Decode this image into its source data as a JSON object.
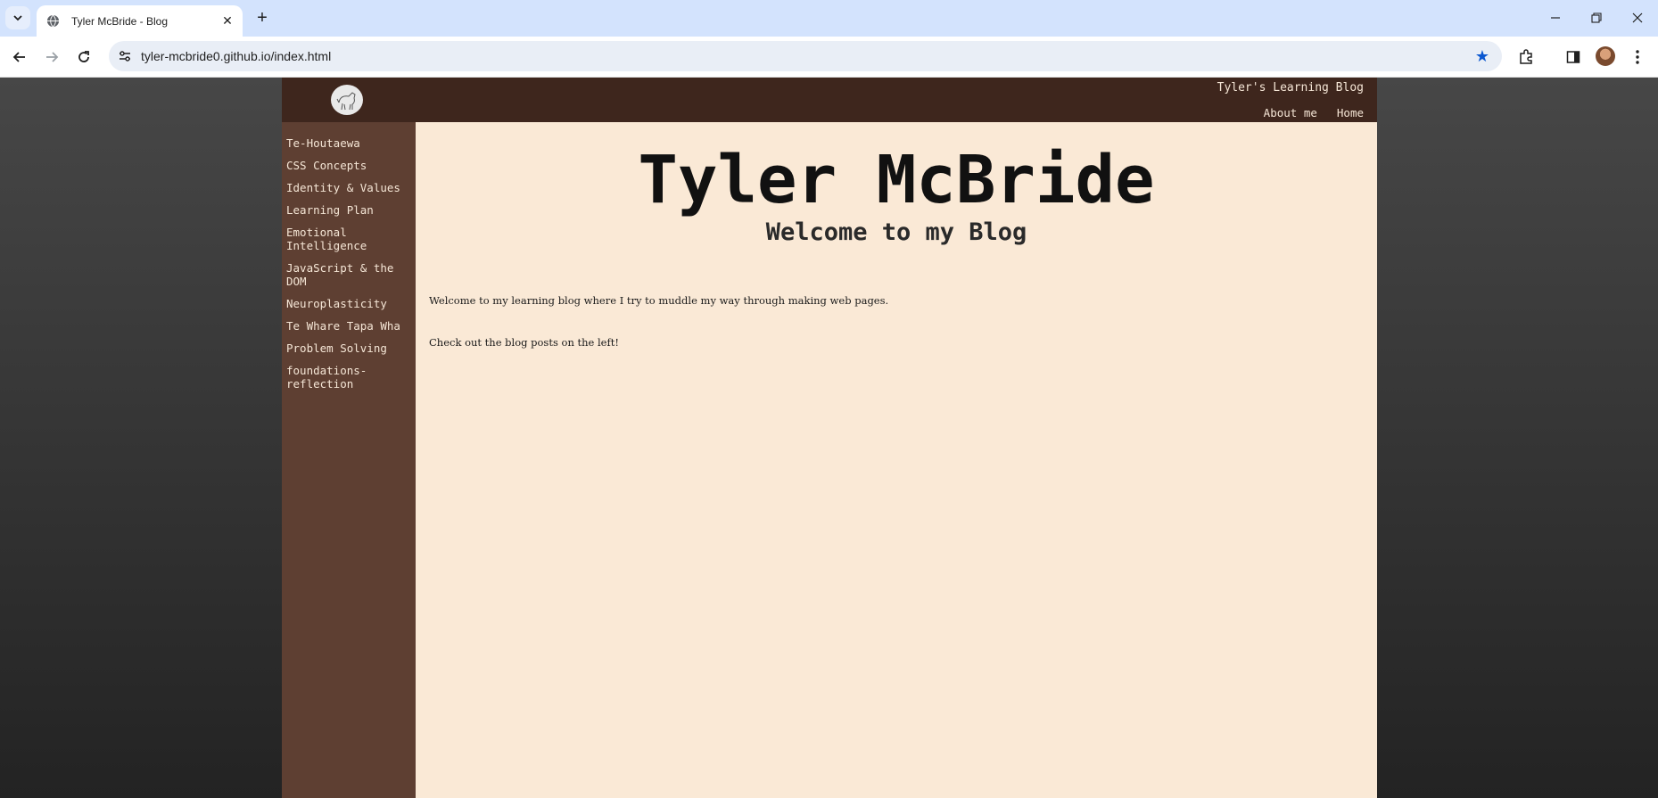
{
  "browser": {
    "tab_title": "Tyler McBride - Blog",
    "url": "tyler-mcbride0.github.io/index.html",
    "new_tab_label": "+",
    "close_tab_label": "✕",
    "minimize_label": "—",
    "restore_label": "❐",
    "close_window_label": "✕"
  },
  "header": {
    "blog_title": "Tyler's Learning Blog",
    "nav": [
      "About me",
      "Home"
    ]
  },
  "sidebar": {
    "items": [
      "Te-Houtaewa",
      "CSS Concepts",
      "Identity & Values",
      "Learning Plan",
      "Emotional Intelligence",
      "JavaScript & the DOM",
      "Neuroplasticity",
      "Te Whare Tapa Wha",
      "Problem Solving",
      "foundations-reflection"
    ]
  },
  "main": {
    "title": "Tyler McBride",
    "subtitle": "Welcome to my Blog",
    "paragraphs": [
      "Welcome to my learning blog where I try to muddle my way through making web pages.",
      "Check out the blog posts on the left!"
    ]
  },
  "colors": {
    "header_bg": "#3e261d",
    "sidebar_bg": "#5e3f32",
    "main_bg": "#fae9d6",
    "accent_star": "#0b57d0"
  },
  "icons": [
    "tab-search-icon",
    "globe-icon",
    "back-icon",
    "forward-icon",
    "reload-icon",
    "site-settings-icon",
    "bookmark-star-icon",
    "extensions-icon",
    "side-panel-icon",
    "menu-icon",
    "dog-logo-icon"
  ]
}
